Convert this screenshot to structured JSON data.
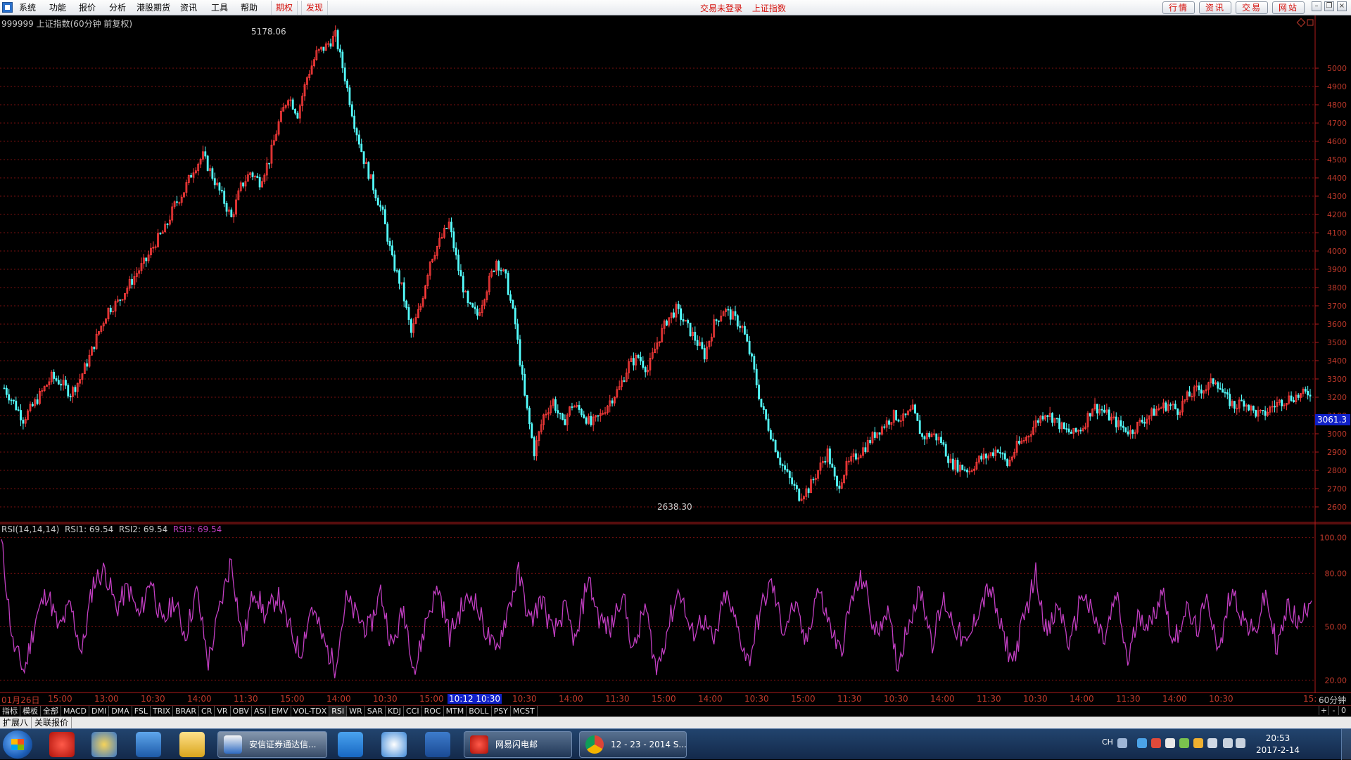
{
  "menubar": {
    "items": [
      "系统",
      "功能",
      "报价",
      "分析",
      "港股期货",
      "资讯",
      "工具",
      "帮助"
    ],
    "special": [
      "期权",
      "发现"
    ],
    "status": [
      "交易未登录",
      "上证指数"
    ],
    "buttons": [
      "行情",
      "资讯",
      "交易",
      "网站"
    ]
  },
  "main": {
    "title": "999999 上证指数(60分钟 前复权)",
    "high_label": "5178.06",
    "low_label": "2638.30",
    "current_price_label": "3061.3",
    "y_ticks": [
      "5000",
      "4900",
      "4800",
      "4700",
      "4600",
      "4500",
      "4400",
      "4300",
      "4200",
      "4100",
      "4000",
      "3900",
      "3800",
      "3700",
      "3600",
      "3500",
      "3400",
      "3300",
      "3200",
      "3100",
      "3000",
      "2900",
      "2800",
      "2700",
      "2600"
    ]
  },
  "rsi": {
    "legend_name": "RSI(14,14,14)",
    "rsi1": "RSI1: 69.54",
    "rsi2": "RSI2: 69.54",
    "rsi3": "RSI3: 69.54",
    "y_ticks": [
      "100.00",
      "80.00",
      "50.00",
      "20.00"
    ]
  },
  "xaxis": {
    "labels": [
      "01月26日",
      "15:00",
      "13:00",
      "10:30",
      "14:00",
      "11:30",
      "15:00",
      "14:00",
      "10:30",
      "15:00",
      "10:12 10:30",
      "10:30",
      "14:00",
      "11:30",
      "15:00",
      "14:00",
      "10:30",
      "15:00",
      "11:30",
      "10:30",
      "14:00",
      "11:30",
      "10:30",
      "14:00",
      "11:30",
      "14:00",
      "10:30",
      "15:"
    ],
    "period": "60分钟"
  },
  "indicators": [
    "指标",
    "模板",
    "全部",
    "MACD",
    "DMI",
    "DMA",
    "FSL",
    "TRIX",
    "BRAR",
    "CR",
    "VR",
    "OBV",
    "ASI",
    "EMV",
    "VOL-TDX",
    "RSI",
    "WR",
    "SAR",
    "KDJ",
    "CCI",
    "ROC",
    "MTM",
    "BOLL",
    "PSY",
    "MCST"
  ],
  "zoom": [
    "+",
    "-",
    "0"
  ],
  "bottom_tabs": [
    "扩展八",
    "关联报价"
  ],
  "taskbar": {
    "tasks": [
      "安信证券通达信...",
      "网易闪电邮",
      "12 - 23 - 2014 S..."
    ],
    "tray_lang": "CH",
    "time": "20:53",
    "date": "2017-2-14"
  },
  "chart_data": [
    {
      "type": "candlestick",
      "title": "999999 上证指数(60分钟 前复权)",
      "ylim": [
        2550,
        5250
      ],
      "annotations": [
        {
          "label": "5178.06",
          "kind": "high"
        },
        {
          "label": "2638.30",
          "kind": "low"
        },
        {
          "label": "3061.3",
          "kind": "last"
        }
      ],
      "series": [
        {
          "values": [
            3250,
            3170,
            3080,
            3150,
            3230,
            3310,
            3280,
            3220,
            3300,
            3420,
            3560,
            3680,
            3720,
            3800,
            3880,
            3950,
            4050,
            4120,
            4250,
            4330,
            4450,
            4520,
            4410,
            4300,
            4180,
            4350,
            4430,
            4380,
            4500,
            4700,
            4850,
            4750,
            4950,
            5080,
            5120,
            5178,
            4950,
            4700,
            4500,
            4350,
            4200,
            3950,
            3800,
            3550,
            3700,
            3950,
            4050,
            4150,
            3900,
            3700,
            3650,
            3800,
            3950,
            3850,
            3600,
            3200,
            2900,
            3100,
            3180,
            3050,
            3160,
            3120,
            3050,
            3100,
            3180,
            3250,
            3380,
            3420,
            3350,
            3500,
            3620,
            3680,
            3600,
            3520,
            3430,
            3600,
            3680,
            3640,
            3580,
            3400,
            3150,
            3000,
            2850,
            2750,
            2660,
            2700,
            2800,
            2900,
            2700,
            2820,
            2880,
            2930,
            3000,
            3050,
            3100,
            3080,
            3130,
            2980,
            3000,
            2960,
            2840,
            2820,
            2800,
            2860,
            2880,
            2920,
            2830,
            2930,
            2980,
            3060,
            3120,
            3080,
            3020,
            3000,
            3040,
            3150,
            3130,
            3080,
            3040,
            3010,
            3060,
            3100,
            3140,
            3160,
            3130,
            3200,
            3240,
            3250,
            3300,
            3200,
            3150,
            3180,
            3120,
            3100,
            3150,
            3180,
            3200,
            3210,
            3230
          ]
        }
      ]
    },
    {
      "type": "line",
      "title": "RSI(14,14,14)",
      "ylim": [
        15,
        105
      ],
      "series": [
        {
          "name": "RSI3",
          "values": [
            98,
            40,
            25,
            55,
            70,
            48,
            62,
            35,
            75,
            82,
            60,
            72,
            55,
            78,
            50,
            65,
            45,
            70,
            30,
            60,
            88,
            40,
            72,
            55,
            68,
            50,
            35,
            62,
            42,
            28,
            65,
            55,
            48,
            70,
            38,
            60,
            25,
            55,
            72,
            45,
            60,
            68,
            50,
            35,
            58,
            80,
            52,
            66,
            45,
            60,
            40,
            78,
            55,
            48,
            70,
            35,
            62,
            25,
            50,
            72,
            45,
            55,
            40,
            68,
            50,
            30,
            58,
            75,
            48,
            62,
            40,
            72,
            52,
            35,
            66,
            78,
            45,
            60,
            28,
            55,
            70,
            42,
            65,
            50,
            38,
            60,
            72,
            48,
            30,
            55,
            80,
            45,
            62,
            38,
            70,
            55,
            42,
            68,
            30,
            58,
            50,
            72,
            40,
            60,
            48,
            65,
            35,
            72,
            55,
            45,
            68,
            38,
            62,
            50,
            70
          ]
        }
      ]
    }
  ]
}
